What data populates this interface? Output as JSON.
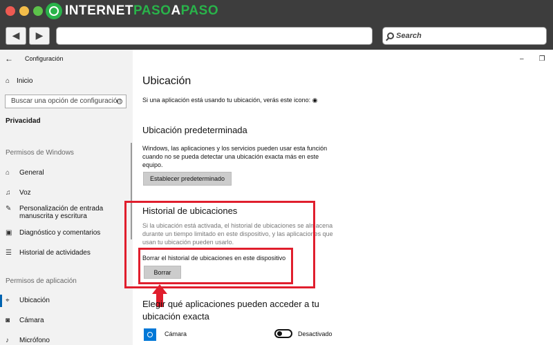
{
  "browser": {
    "logo_part1": "INTERNET",
    "logo_part2": "PASO",
    "logo_part3": "A",
    "logo_part4": "PASO",
    "back_glyph": "◀",
    "forward_glyph": "▶",
    "search_placeholder": "Search",
    "colors": {
      "chrome": "#3d3d3d",
      "brand_green": "#29b34a"
    }
  },
  "settings": {
    "window_title": "Configuración",
    "back_glyph": "←",
    "sidebar": {
      "home_label": "Inicio",
      "search_placeholder": "Buscar una opción de configuración",
      "category": "Privacidad",
      "section_windows": "Permisos de Windows",
      "items_windows": [
        {
          "icon": "shield-icon",
          "label": "General"
        },
        {
          "icon": "microphone-icon",
          "label": "Voz"
        },
        {
          "icon": "handwriting-icon",
          "label": "Personalización de entrada manuscrita y escritura"
        },
        {
          "icon": "feedback-icon",
          "label": "Diagnóstico y comentarios"
        },
        {
          "icon": "timeline-icon",
          "label": "Historial de actividades"
        }
      ],
      "section_apps": "Permisos de aplicación",
      "items_apps": [
        {
          "icon": "location-icon",
          "label": "Ubicación",
          "active": true
        },
        {
          "icon": "camera-icon",
          "label": "Cámara"
        },
        {
          "icon": "microphone-icon",
          "label": "Micrófono"
        }
      ]
    },
    "main": {
      "title": "Ubicación",
      "intro": "Si una aplicación está usando tu ubicación, verás este icono:",
      "default_heading": "Ubicación predeterminada",
      "default_desc": "Windows, las aplicaciones y los servicios pueden usar esta función cuando no se pueda detectar una ubicación exacta más en este equipo.",
      "default_button": "Establecer predeterminado",
      "history_heading": "Historial de ubicaciones",
      "history_desc": "Si la ubicación está activada, el historial de ubicaciones se almacena durante un tiempo limitado en este dispositivo, y las aplicaciones que usan tu ubicación pueden usarlo.",
      "clear_label": "Borrar el historial de ubicaciones en este dispositivo",
      "clear_button": "Borrar",
      "apps_heading": "Elegir qué aplicaciones pueden acceder a tu ubicación exacta",
      "app_row": {
        "name": "Cámara",
        "toggle_state": "Desactivado"
      }
    },
    "colors": {
      "highlight": "#e01e2d",
      "accent": "#0063b1"
    }
  }
}
